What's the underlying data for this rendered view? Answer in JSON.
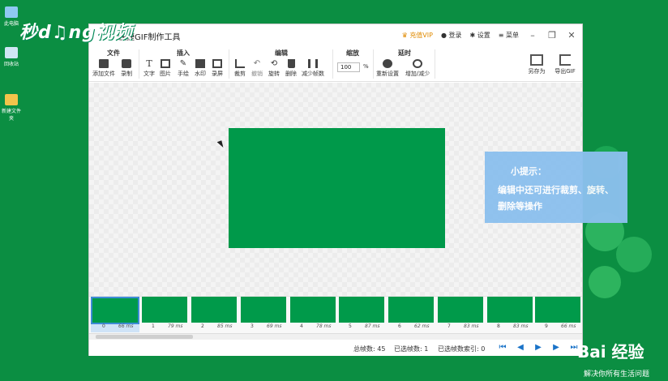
{
  "desktop": {
    "icons": [
      {
        "label": "此电脑",
        "icon": "computer-icon",
        "color": "#8fc9f2"
      },
      {
        "label": "回收站",
        "icon": "recycle-bin-icon",
        "color": "#cfe6f4"
      },
      {
        "label": "新建文件夹",
        "icon": "folder-icon",
        "color": "#f2c44b"
      }
    ]
  },
  "watermark": {
    "top": "秒d♫ng视频",
    "brand": "Bai 经验",
    "slogan": "解决你所有生活问题"
  },
  "app": {
    "title": "快捷GIF制作工具",
    "topbar": {
      "vip": "充值VIP",
      "login": "登录",
      "settings": "设置",
      "menu": "菜单"
    },
    "ribbon": {
      "groups": {
        "file": "文件",
        "insert": "插入",
        "edit": "编辑",
        "zoom": "缩放",
        "delay": "延时"
      },
      "tools": {
        "add_file": "添加文件",
        "record": "录制",
        "text": "文字",
        "image": "图片",
        "hand_draw": "手绘",
        "watermark": "水印",
        "screen_record": "录屏",
        "crop": "裁剪",
        "undo": "撤销",
        "rotate": "旋转",
        "delete": "删除",
        "reduce_frames": "减少帧数",
        "reset": "重新设置",
        "add_reduce": "增加/减少",
        "save_as": "另存为",
        "export_gif": "导出GIF"
      },
      "zoom_value": "100",
      "zoom_unit": "%"
    },
    "frames": [
      {
        "index": "0",
        "ms": "66 ms"
      },
      {
        "index": "1",
        "ms": "79 ms"
      },
      {
        "index": "2",
        "ms": "85 ms"
      },
      {
        "index": "3",
        "ms": "69 ms"
      },
      {
        "index": "4",
        "ms": "78 ms"
      },
      {
        "index": "5",
        "ms": "87 ms"
      },
      {
        "index": "6",
        "ms": "62 ms"
      },
      {
        "index": "7",
        "ms": "83 ms"
      },
      {
        "index": "8",
        "ms": "83 ms"
      },
      {
        "index": "9",
        "ms": "66 ms"
      }
    ],
    "status": {
      "total_frames": "总帧数: 45",
      "selected_frames": "已选帧数: 1",
      "selected_index": "已选帧数索引: 0"
    }
  },
  "tip": {
    "title": "小提示：",
    "body": "编辑中还可进行裁剪、旋转、删除等操作"
  },
  "colors": {
    "frame_green": "#00994a",
    "accent_blue": "#1a73c8",
    "tip_bg": "#8cc0ee"
  }
}
